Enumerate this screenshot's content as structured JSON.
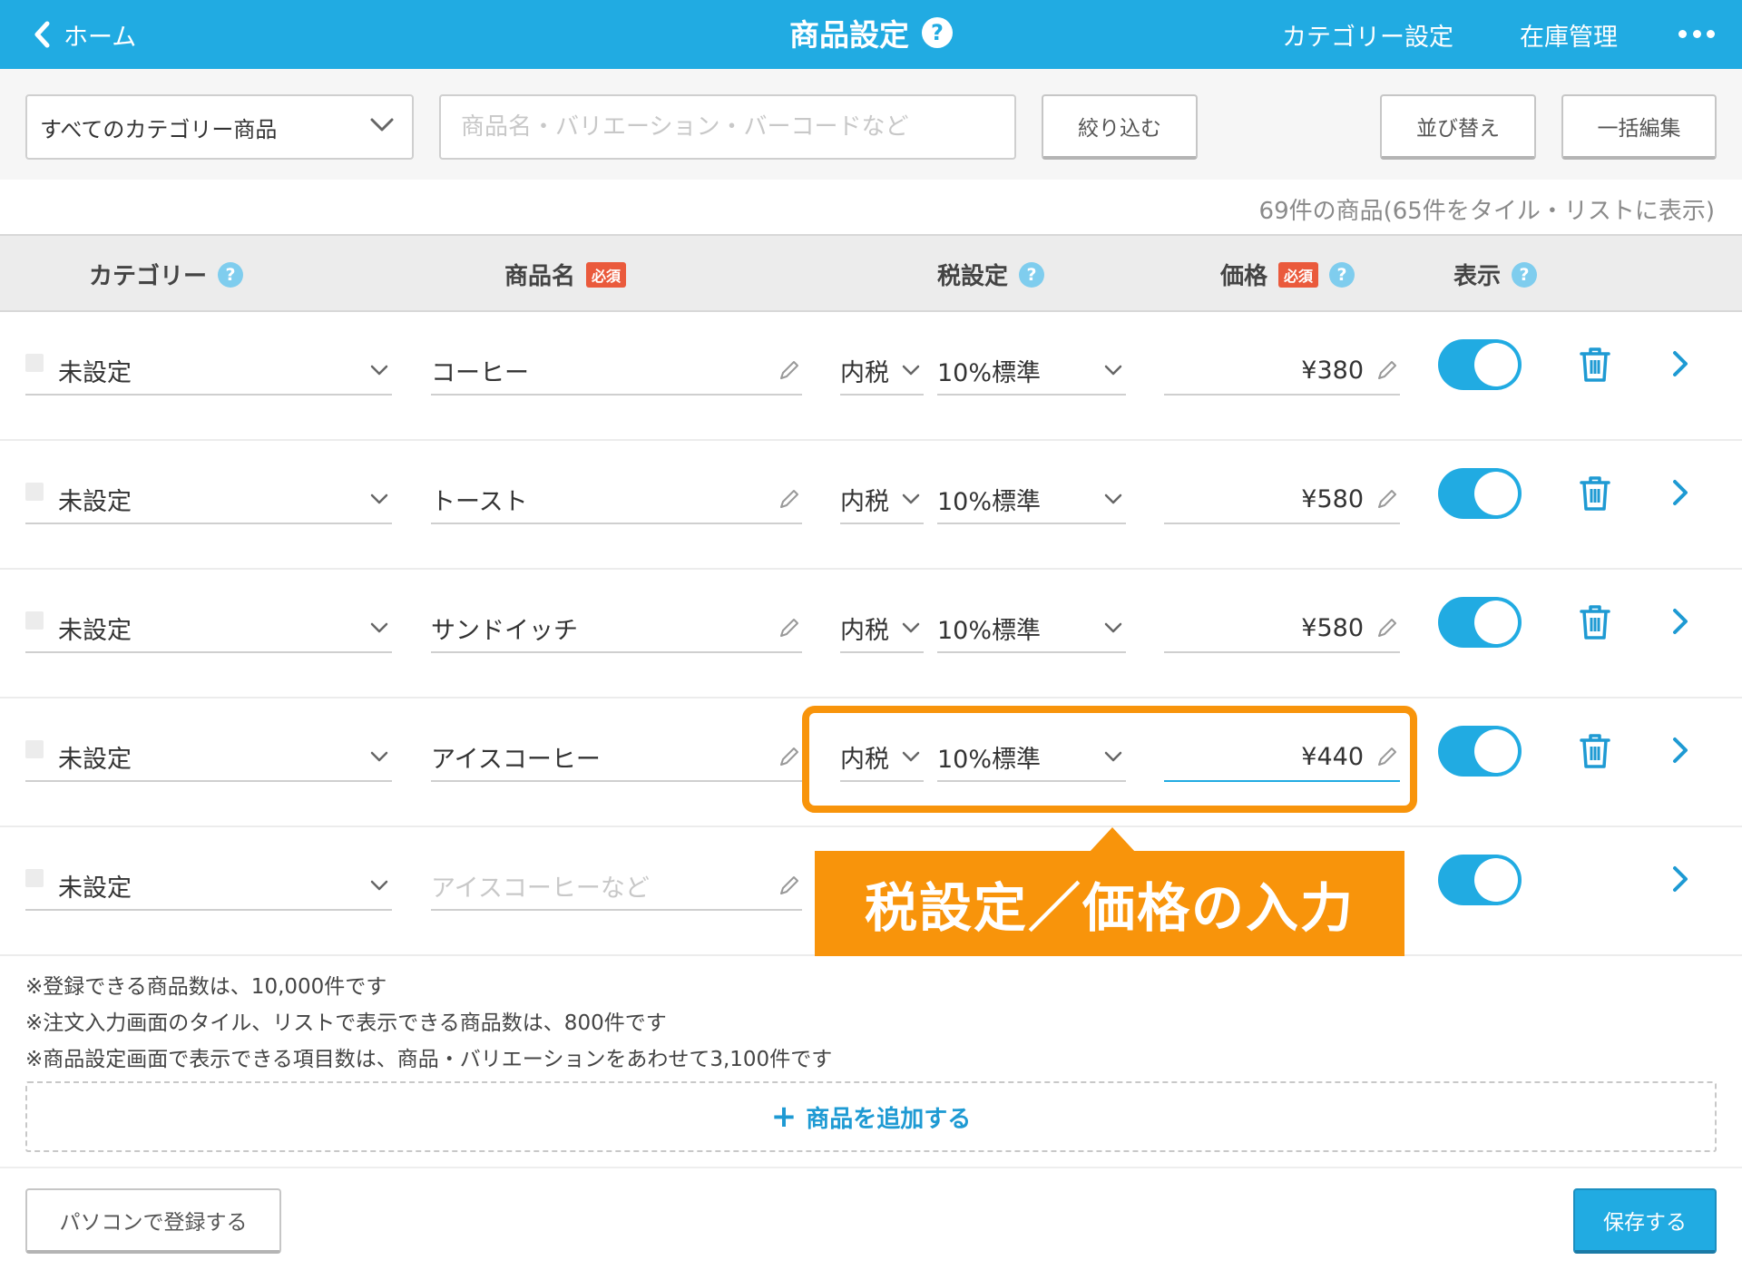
{
  "header": {
    "back_label": "ホーム",
    "title": "商品設定",
    "help": "?",
    "nav": [
      "カテゴリー設定",
      "在庫管理"
    ]
  },
  "toolbar": {
    "category_select": "すべてのカテゴリー商品",
    "search_placeholder": "商品名・バリエーション・バーコードなど",
    "filter_label": "絞り込む",
    "sort_label": "並び替え",
    "bulk_edit_label": "一括編集"
  },
  "count_text": "69件の商品(65件をタイル・リストに表示)",
  "columns": {
    "category": "カテゴリー",
    "name": "商品名",
    "tax": "税設定",
    "price": "価格",
    "display": "表示",
    "required": "必須",
    "help": "?"
  },
  "rows": [
    {
      "category": "未設定",
      "name": "コーヒー",
      "tax_type": "内税",
      "tax_rate": "10%標準",
      "price": "¥380"
    },
    {
      "category": "未設定",
      "name": "トースト",
      "tax_type": "内税",
      "tax_rate": "10%標準",
      "price": "¥580"
    },
    {
      "category": "未設定",
      "name": "サンドイッチ",
      "tax_type": "内税",
      "tax_rate": "10%標準",
      "price": "¥580"
    },
    {
      "category": "未設定",
      "name": "アイスコーヒー",
      "tax_type": "内税",
      "tax_rate": "10%標準",
      "price": "¥440"
    },
    {
      "category": "未設定",
      "name_placeholder": "アイスコーヒーなど"
    }
  ],
  "notes": [
    "※登録できる商品数は、10,000件です",
    "※注文入力画面のタイル、リストで表示できる商品数は、800件です",
    "※商品設定画面で表示できる項目数は、商品・バリエーションをあわせて3,100件です"
  ],
  "add_product_label": "商品を追加する",
  "footer": {
    "pc_register_label": "パソコンで登録する",
    "save_label": "保存する"
  },
  "callout_text": "税設定／価格の入力",
  "colors": {
    "header_blue": "#21abe2",
    "accent_orange": "#f8940b",
    "required_red": "#ea5a3c"
  }
}
